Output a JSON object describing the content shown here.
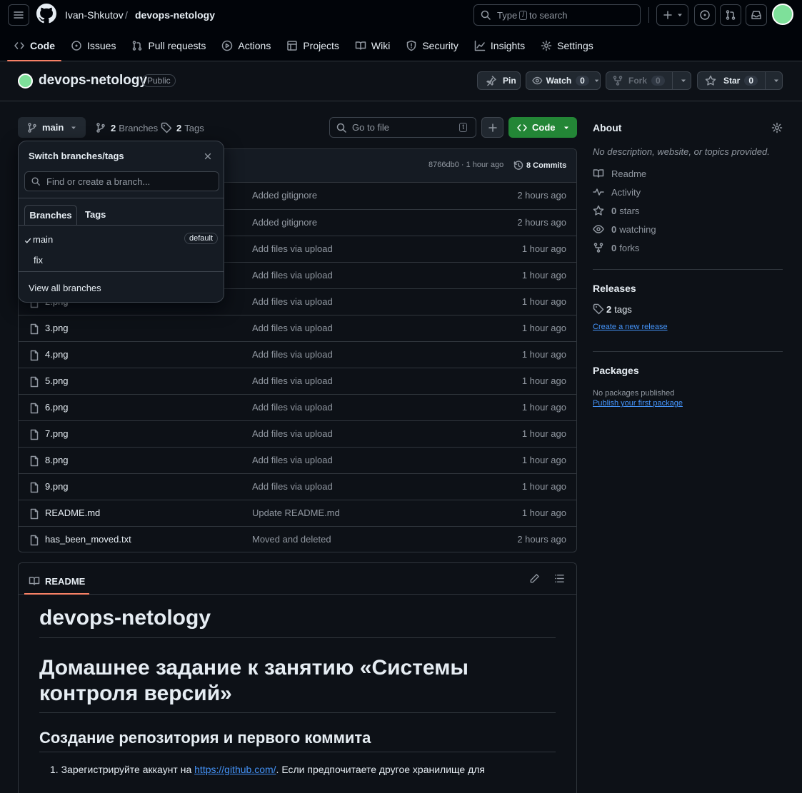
{
  "header": {
    "owner": "Ivan-Shkutov",
    "separator": "/",
    "repo": "devops-netology",
    "search_prefix": "Type",
    "search_key": "/",
    "search_suffix": "to search"
  },
  "tabs": [
    {
      "label": "Code",
      "icon": "code-icon"
    },
    {
      "label": "Issues",
      "icon": "issue-icon"
    },
    {
      "label": "Pull requests",
      "icon": "pull-request-icon"
    },
    {
      "label": "Actions",
      "icon": "play-icon"
    },
    {
      "label": "Projects",
      "icon": "table-icon"
    },
    {
      "label": "Wiki",
      "icon": "book-icon"
    },
    {
      "label": "Security",
      "icon": "shield-icon"
    },
    {
      "label": "Insights",
      "icon": "graph-icon"
    },
    {
      "label": "Settings",
      "icon": "gear-icon"
    }
  ],
  "repo_header": {
    "name": "devops-netology",
    "visibility": "Public",
    "pin_label": "Pin",
    "watch_label": "Watch",
    "watch_count": "0",
    "fork_label": "Fork",
    "fork_count": "0",
    "star_label": "Star",
    "star_count": "0"
  },
  "toolbar": {
    "branch": "main",
    "branches_count": "2",
    "branches_label": "Branches",
    "tags_count": "2",
    "tags_label": "Tags",
    "goto_placeholder": "Go to file",
    "goto_key": "t",
    "code_label": "Code"
  },
  "commit_bar": {
    "hash_time": "8766db0 · 1 hour ago",
    "commits_label": "8 Commits"
  },
  "branch_dropdown": {
    "title": "Switch branches/tags",
    "find_placeholder": "Find or create a branch...",
    "tab_branches": "Branches",
    "tab_tags": "Tags",
    "branches": [
      {
        "name": "main",
        "badge": "default",
        "selected": true
      },
      {
        "name": "fix",
        "badge": "",
        "selected": false
      }
    ],
    "view_all": "View all branches"
  },
  "files": [
    {
      "name": "",
      "message": "Added gitignore",
      "age": "2 hours ago"
    },
    {
      "name": "",
      "message": "Added gitignore",
      "age": "2 hours ago"
    },
    {
      "name": "",
      "message": "Add files via upload",
      "age": "1 hour ago"
    },
    {
      "name": "",
      "message": "Add files via upload",
      "age": "1 hour ago"
    },
    {
      "name": "2.png",
      "message": "Add files via upload",
      "age": "1 hour ago"
    },
    {
      "name": "3.png",
      "message": "Add files via upload",
      "age": "1 hour ago"
    },
    {
      "name": "4.png",
      "message": "Add files via upload",
      "age": "1 hour ago"
    },
    {
      "name": "5.png",
      "message": "Add files via upload",
      "age": "1 hour ago"
    },
    {
      "name": "6.png",
      "message": "Add files via upload",
      "age": "1 hour ago"
    },
    {
      "name": "7.png",
      "message": "Add files via upload",
      "age": "1 hour ago"
    },
    {
      "name": "8.png",
      "message": "Add files via upload",
      "age": "1 hour ago"
    },
    {
      "name": "9.png",
      "message": "Add files via upload",
      "age": "1 hour ago"
    },
    {
      "name": "README.md",
      "message": "Update README.md",
      "age": "1 hour ago"
    },
    {
      "name": "has_been_moved.txt",
      "message": "Moved and deleted",
      "age": "2 hours ago"
    }
  ],
  "readme": {
    "tab_label": "README",
    "h1": "devops-netology",
    "h1b": "Домашнее задание к занятию «Системы контроля версий»",
    "h2": "Создание репозитория и первого коммита",
    "item1_prefix": "Зарегистрируйте аккаунт на ",
    "item1_link": "https://github.com/",
    "item1_suffix": ". Если предпочитаете другое хранилище для"
  },
  "about": {
    "title": "About",
    "description": "No description, website, or topics provided.",
    "readme": "Readme",
    "activity": "Activity",
    "stars_count": "0",
    "stars_label": "stars",
    "watching_count": "0",
    "watching_label": "watching",
    "forks_count": "0",
    "forks_label": "forks"
  },
  "releases": {
    "title": "Releases",
    "tags_count": "2",
    "tags_label": "tags",
    "create_link": "Create a new release"
  },
  "packages": {
    "title": "Packages",
    "none": "No packages published",
    "publish_link": "Publish your first package"
  },
  "colors": {
    "accent_orange": "#f78166",
    "green_button": "#238636",
    "link_blue": "#4493f8",
    "background": "#0d1117"
  }
}
